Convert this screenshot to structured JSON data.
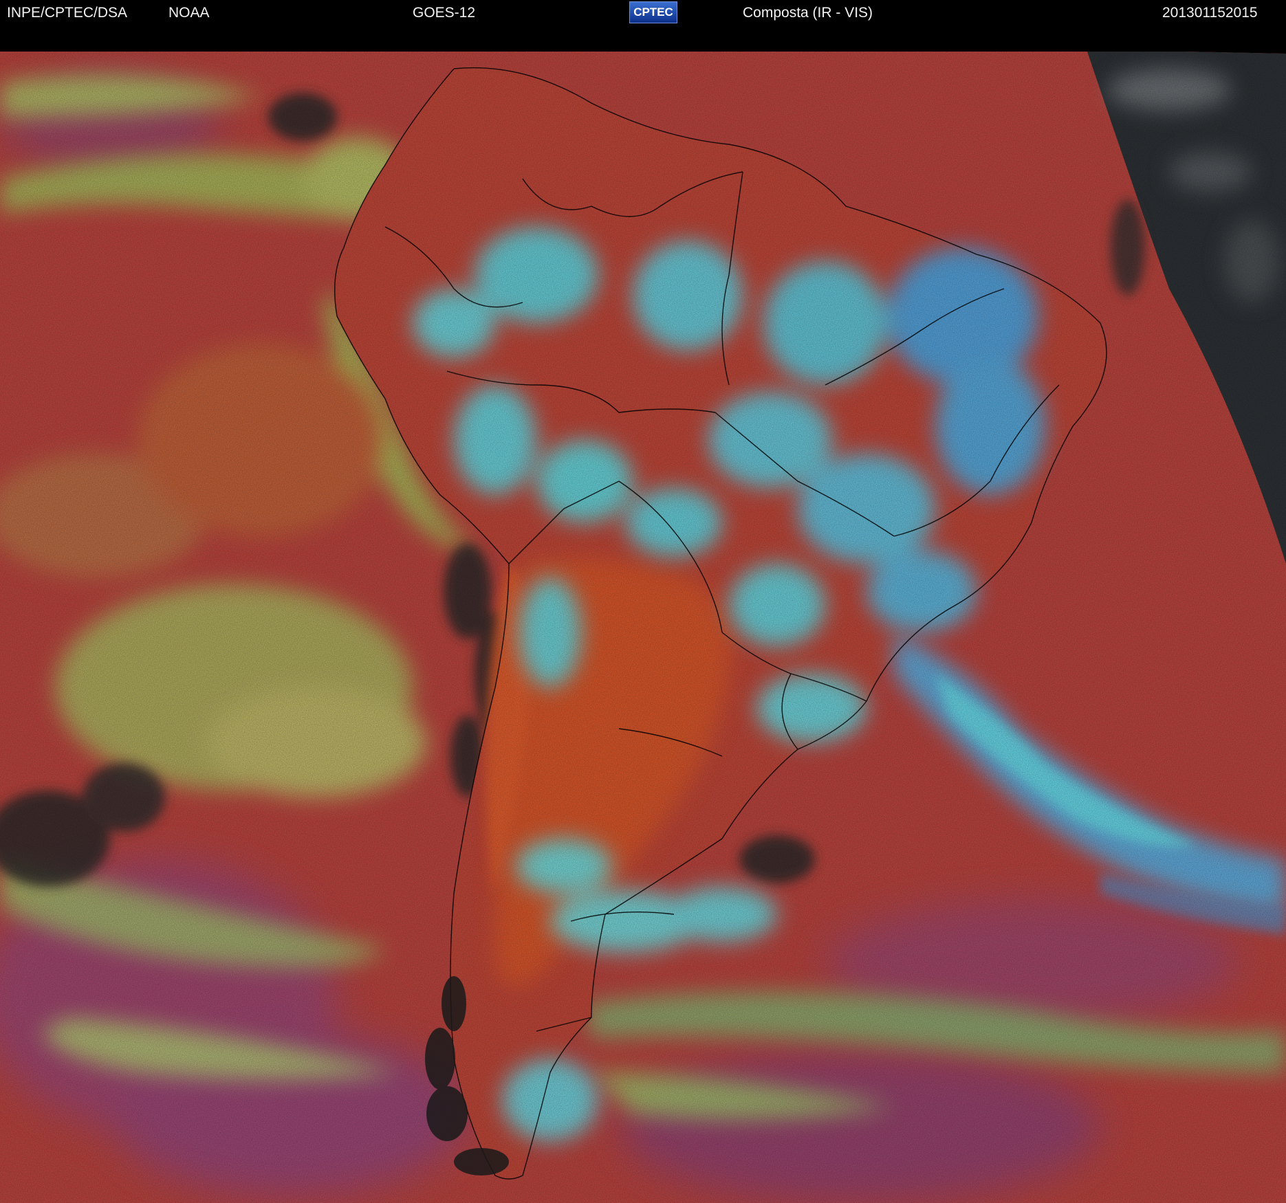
{
  "header": {
    "source": "INPE/CPTEC/DSA",
    "agency": "NOAA",
    "satellite": "GOES-12",
    "logo_text": "CPTEC",
    "product": "Composta (IR - VIS)",
    "timestamp": "201301152015"
  },
  "colors": {
    "background": "#000000",
    "clear_land_ocean": "#c0463e",
    "warm_land": "#e0552c",
    "low_cloud": "#a8d95c",
    "high_cloud": "#5fe6ec",
    "deep_cloud": "#4aa8f0",
    "cirrus_magenta": "#a04a7a",
    "night_gray": "#2e3236",
    "borders": "#000000"
  }
}
